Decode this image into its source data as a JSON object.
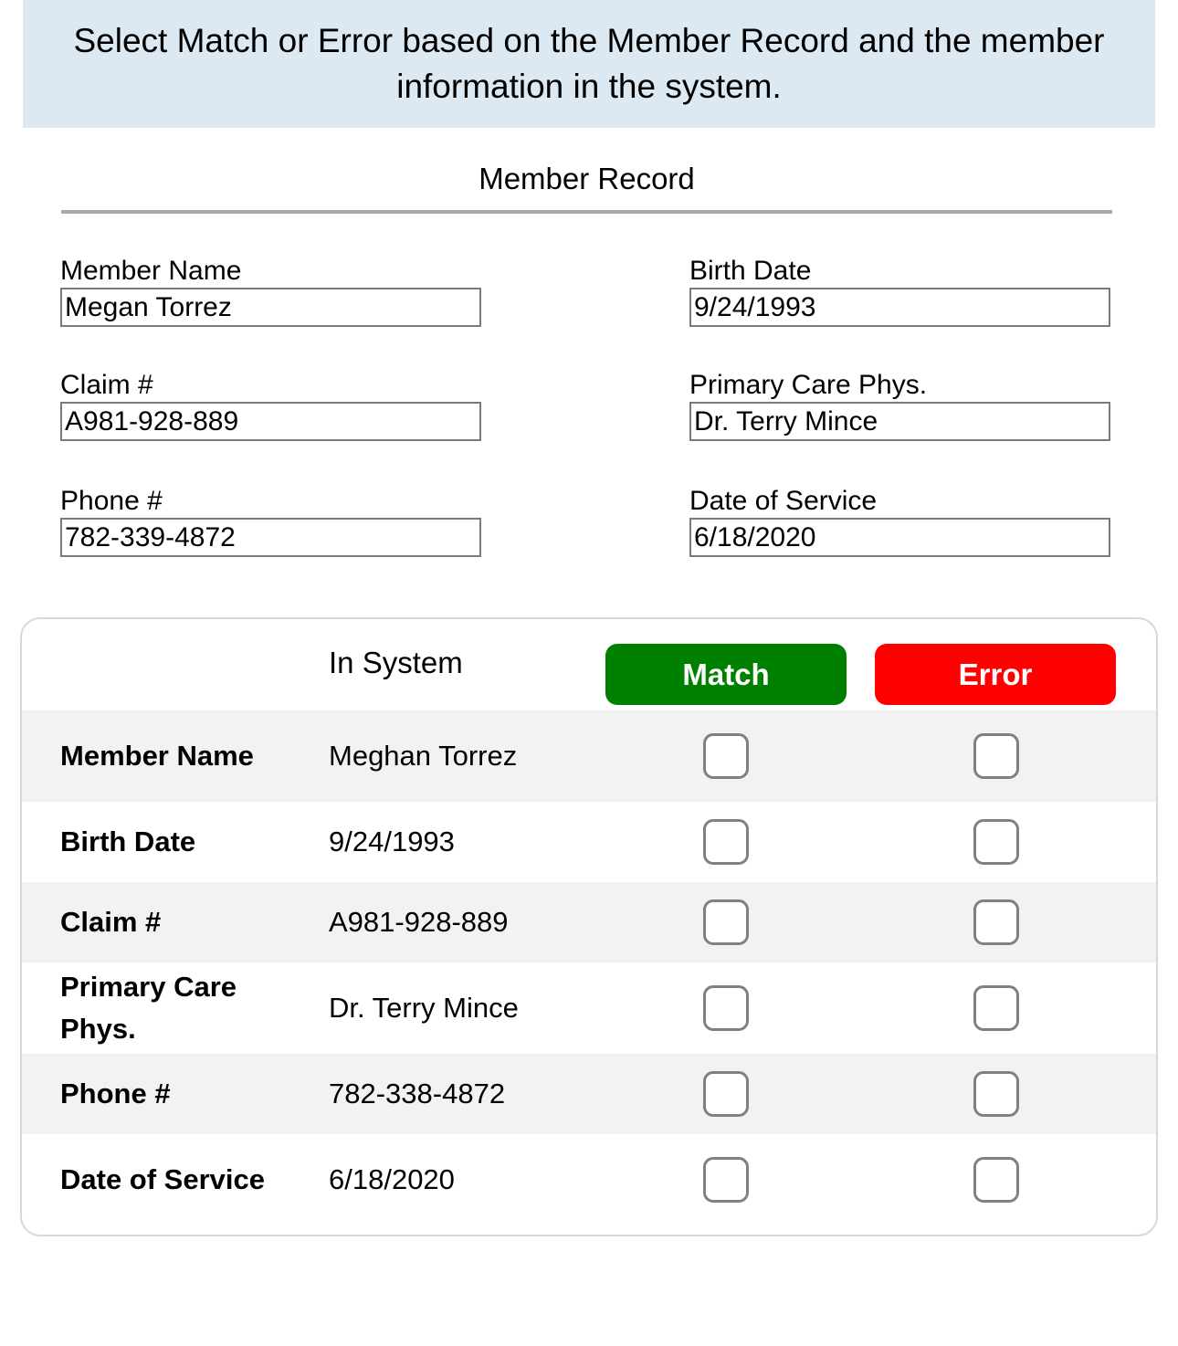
{
  "banner": {
    "instruction": "Select Match or Error based on the Member Record and the member information in the system."
  },
  "record": {
    "title": "Member Record",
    "fields": [
      {
        "label": "Member Name",
        "value": "Megan Torrez"
      },
      {
        "label": "Birth Date",
        "value": "9/24/1993"
      },
      {
        "label": "Claim #",
        "value": "A981-928-889"
      },
      {
        "label": "Primary Care Phys.",
        "value": "Dr. Terry Mince"
      },
      {
        "label": "Phone #",
        "value": "782-339-4872"
      },
      {
        "label": "Date of Service",
        "value": "6/18/2020"
      }
    ]
  },
  "comparison": {
    "header": {
      "in_system": "In System",
      "match_label": "Match",
      "error_label": "Error",
      "match_color": "#008000",
      "error_color": "#fe0000"
    },
    "rows": [
      {
        "label": "Member Name",
        "value": "Meghan Torrez"
      },
      {
        "label": "Birth Date",
        "value": "9/24/1993"
      },
      {
        "label": "Claim #",
        "value": "A981-928-889"
      },
      {
        "label": "Primary Care Phys.",
        "value": "Dr. Terry Mince"
      },
      {
        "label": "Phone #",
        "value": "782-338-4872"
      },
      {
        "label": "Date of Service",
        "value": "6/18/2020"
      }
    ]
  }
}
